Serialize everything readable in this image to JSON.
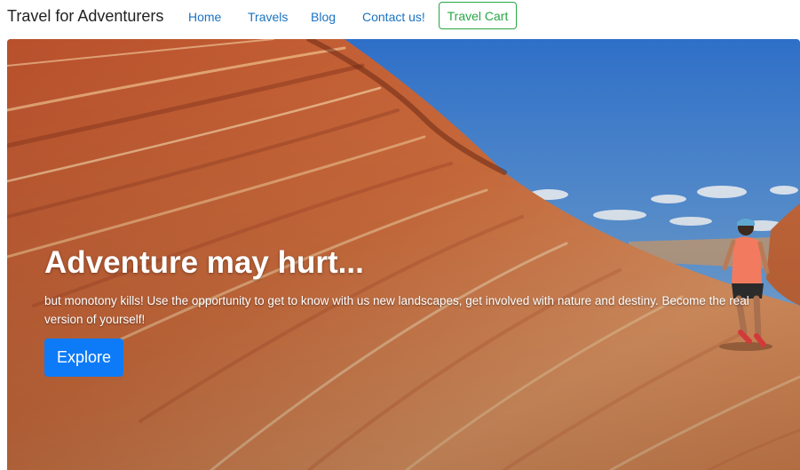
{
  "navbar": {
    "brand": "Travel for Adventurers",
    "links": [
      {
        "label": "Home"
      },
      {
        "label": "Travels"
      },
      {
        "label": "Blog"
      },
      {
        "label": "Contact us!"
      }
    ],
    "cart_label": "Travel Cart"
  },
  "hero": {
    "title": "Adventure may hurt...",
    "text": "but monotony kills! Use the opportunity to get to know with us new landscapes, get involved with nature and destiny. Become the real version of yourself!",
    "button_label": "Explore"
  },
  "colors": {
    "link": "#1a73c2",
    "cart_accent": "#28a745",
    "primary_button": "#0d7bf7"
  }
}
